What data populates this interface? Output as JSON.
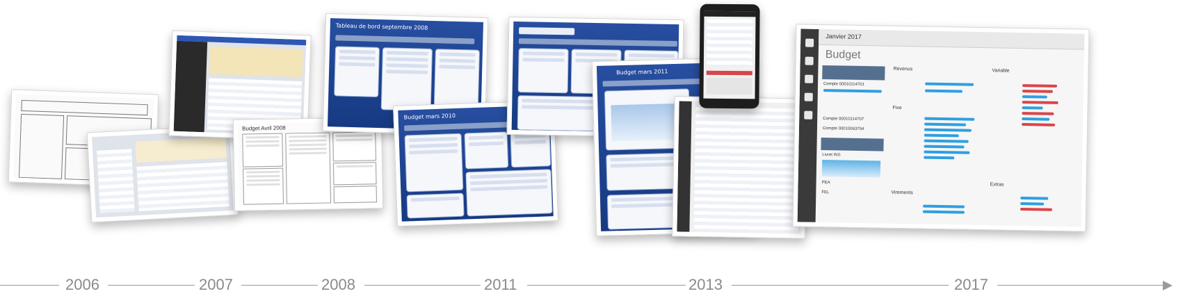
{
  "timeline": {
    "years": [
      "2006",
      "2007",
      "2008",
      "2011",
      "2013",
      "2017"
    ]
  },
  "screens": {
    "s2007_title": "Budget Avril 2008",
    "s2008_title": "Tableau de bord septembre 2008",
    "s2011a_title": "Budget mars 2010",
    "s2011b_title": "Budget mars 2011",
    "s2013_title": "Budget mars 2011",
    "s2017": {
      "month": "Janvier 2017",
      "title": "Budget",
      "sections": [
        "Revenus",
        "Fixe",
        "Variable",
        "Extras",
        "Virements"
      ],
      "accounts": [
        "Compte 00010114701",
        "Compte 00010114707",
        "Compte 00010063704",
        "Livret INS",
        "PEA",
        "FEL"
      ]
    }
  },
  "colors": {
    "blue_app": "#1c4491",
    "timeline": "#9a9a9a",
    "bar_blue": "#2f9fe0",
    "bar_red": "#d9454a"
  }
}
